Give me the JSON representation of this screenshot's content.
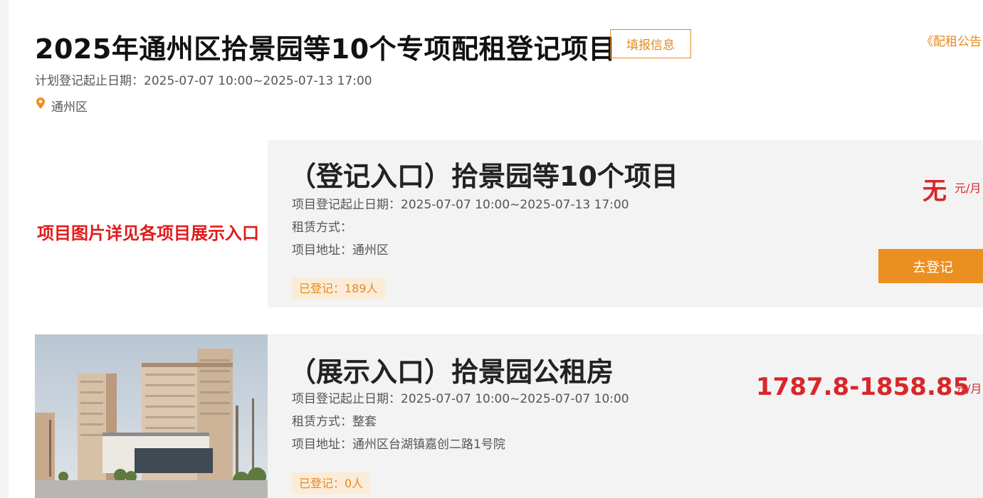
{
  "header": {
    "title": "2025年通州区拾景园等10个专项配租登记项目",
    "fill_button": "填报信息",
    "notice_link": "《配租公告",
    "plan_dates": "计划登记起止日期：2025-07-07 10:00~2025-07-13 17:00",
    "district": "通州区"
  },
  "projects": [
    {
      "image_caption": "项目图片详见各项目展示入口",
      "title": "（登记入口）拾景园等10个项目",
      "dates": "项目登记起止日期：2025-07-07 10:00~2025-07-13 17:00",
      "lease": "租赁方式：",
      "address": "项目地址：通州区",
      "registered": "已登记：189人",
      "price": "无",
      "unit": "元/月",
      "action": "去登记"
    },
    {
      "title": "（展示入口）拾景园公租房",
      "dates": "项目登记起止日期：2025-07-07 10:00~2025-07-07 10:00",
      "lease": "租赁方式：整套",
      "address": "项目地址：通州区台湖镇嘉创二路1号院",
      "registered": "已登记：0人",
      "price": "1787.8-1858.85",
      "unit": "元/月"
    }
  ],
  "colors": {
    "accent": "#e48a1f",
    "price_red": "#d9262b",
    "caption_red": "#e01b1b",
    "card_bg": "#f3f3f3"
  },
  "icons": {
    "location": "location-pin-icon"
  }
}
